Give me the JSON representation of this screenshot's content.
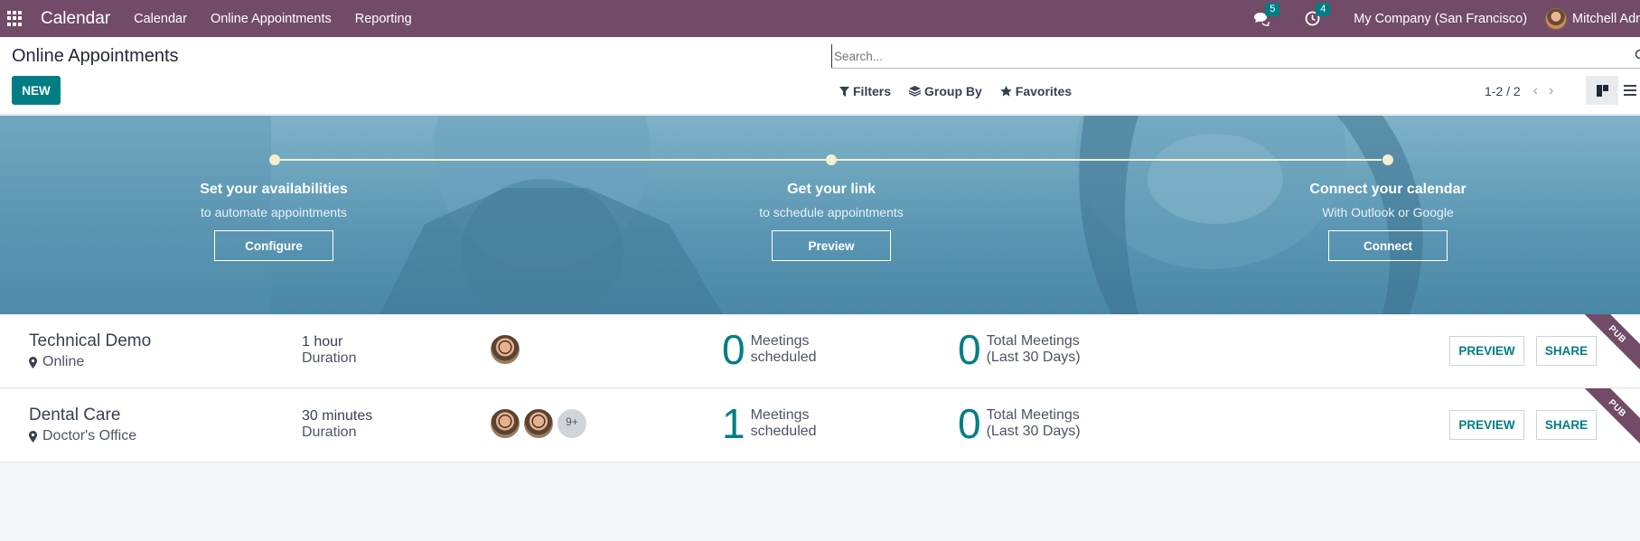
{
  "topbar": {
    "app_name": "Calendar",
    "menu": [
      "Calendar",
      "Online Appointments",
      "Reporting"
    ],
    "messages_count": "5",
    "activities_count": "4",
    "company": "My Company (San Francisco)",
    "user": "Mitchell Adr"
  },
  "control": {
    "page_title": "Online Appointments",
    "new_label": "NEW",
    "search_placeholder": "Search...",
    "filters_label": "Filters",
    "groupby_label": "Group By",
    "favorites_label": "Favorites",
    "pager": "1-2 / 2"
  },
  "banner": {
    "steps": [
      {
        "title": "Set your availabilities",
        "subtitle": "to automate appointments",
        "button": "Configure"
      },
      {
        "title": "Get your link",
        "subtitle": "to schedule appointments",
        "button": "Preview"
      },
      {
        "title": "Connect your calendar",
        "subtitle": "With Outlook or Google",
        "button": "Connect"
      }
    ]
  },
  "records": [
    {
      "name": "Technical Demo",
      "location": "Online",
      "duration": "1 hour",
      "duration_label": "Duration",
      "meetings_count": "0",
      "meetings_label_1": "Meetings",
      "meetings_label_2": "scheduled",
      "total_count": "0",
      "total_label_1": "Total Meetings",
      "total_label_2": "(Last 30 Days)",
      "preview_label": "PREVIEW",
      "share_label": "SHARE",
      "ribbon": "PUB"
    },
    {
      "name": "Dental Care",
      "location": "Doctor's Office",
      "duration": "30 minutes",
      "duration_label": "Duration",
      "more_users": "9+",
      "meetings_count": "1",
      "meetings_label_1": "Meetings",
      "meetings_label_2": "scheduled",
      "total_count": "0",
      "total_label_1": "Total Meetings",
      "total_label_2": "(Last 30 Days)",
      "preview_label": "PREVIEW",
      "share_label": "SHARE",
      "ribbon": "PUB"
    }
  ],
  "colors": {
    "brand": "#714b67",
    "accent": "#017e84",
    "banner": "#5c97b4"
  }
}
